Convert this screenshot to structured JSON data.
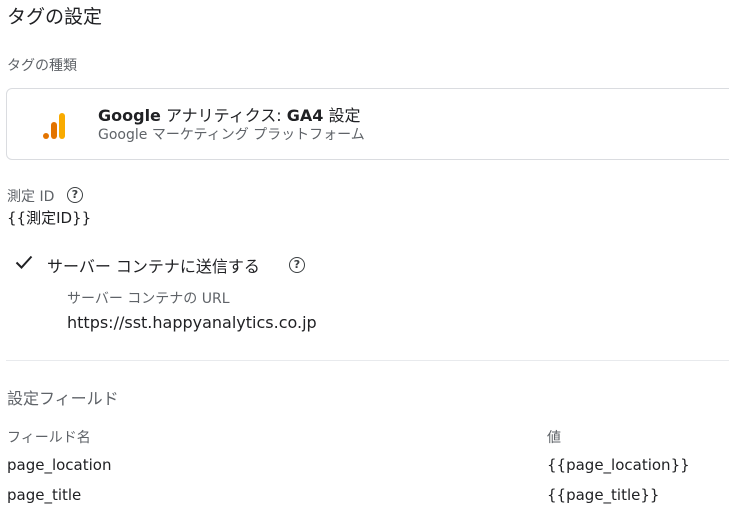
{
  "page": {
    "title": "タグの設定"
  },
  "tag_type": {
    "label": "タグの種類",
    "name_prefix": "Google",
    "name_suffix": " アナリティクス: ",
    "name_bold": "GA4",
    "name_tail": " 設定",
    "vendor": "Google マーケティング プラットフォーム",
    "logo": "google-analytics-icon"
  },
  "measurement_id": {
    "label": "測定 ID",
    "value": "{{測定ID}}",
    "help_icon": "help-icon"
  },
  "server_container": {
    "checkbox_label": "サーバー コンテナに送信する",
    "checked": true,
    "url_label": "サーバー コンテナの URL",
    "url_value": "https://sst.happyanalytics.co.jp"
  },
  "fields": {
    "title": "設定フィールド",
    "columns": [
      "フィールド名",
      "値"
    ],
    "rows": [
      {
        "name": "page_location",
        "value": "{{page_location}}"
      },
      {
        "name": "page_title",
        "value": "{{page_title}}"
      }
    ]
  },
  "colors": {
    "ga_orange_dark": "#e37400",
    "ga_orange_light": "#f9ab00",
    "text_primary": "#202124",
    "text_secondary": "#5f6368"
  }
}
